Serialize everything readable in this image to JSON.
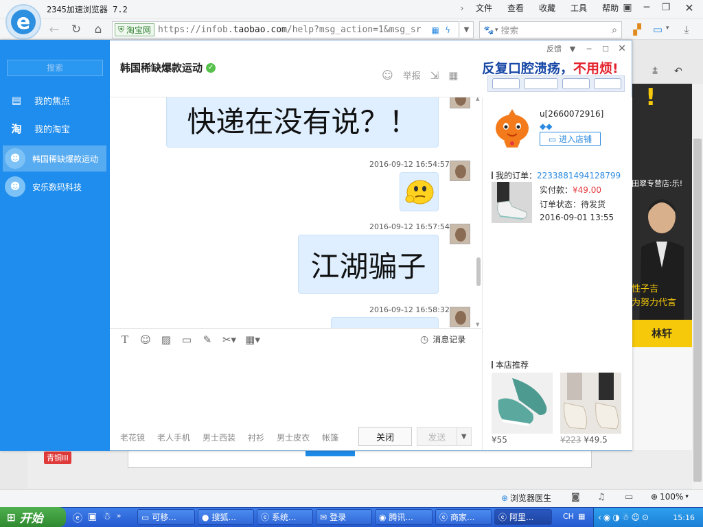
{
  "browser": {
    "title": "2345加速浏览器 7.2",
    "menu": [
      "文件",
      "查看",
      "收藏",
      "工具",
      "帮助"
    ],
    "site_badge": "淘宝网",
    "url_prefix": "https://infob.",
    "url_domain": "taobao.com",
    "url_rest": "/help?msg_action=1&msg_sr",
    "search_placeholder": "搜索",
    "icons": [
      "back-icon",
      "refresh-icon",
      "home-icon",
      "lightning-icon",
      "download-icon"
    ]
  },
  "background_page": {
    "banner_top": "!",
    "banner_shop": "田翠专营店:乐!",
    "banner_slogan": "性子吉\n为努力代言",
    "banner_name": "林轩",
    "badge": "青铜III"
  },
  "chat": {
    "window_controls": {
      "feedback": "反馈"
    },
    "sidebar": {
      "search": "搜索",
      "items": [
        {
          "label": "我的焦点",
          "icon": "focus-icon"
        },
        {
          "label": "我的淘宝",
          "icon": "taobao-icon"
        },
        {
          "label": "韩国稀缺爆款运动",
          "icon": "store-avatar",
          "active": true
        },
        {
          "label": "安乐数码科技",
          "icon": "store-avatar"
        }
      ]
    },
    "header": {
      "title": "韩国稀缺爆款运动",
      "report": "举报"
    },
    "ad": {
      "text_blue": "反复口腔溃疡，",
      "text_red": "不用烦!"
    },
    "messages": [
      {
        "text": "快递在没有说？！"
      },
      {
        "time": "2016-09-12 16:54:57",
        "type": "emoji"
      },
      {
        "time": "2016-09-12 16:57:54",
        "text": "江湖骗子"
      },
      {
        "time": "2016-09-12 16:58:32"
      }
    ],
    "input": {
      "history_label": "消息记录",
      "phrases": [
        "老花镜",
        "老人手机",
        "男士西装",
        "衬衫",
        "男士皮衣",
        "帐篷"
      ],
      "close_label": "关闭",
      "send_label": "发送"
    },
    "info": {
      "user": "u[2660072916]",
      "diamonds": "💎💎",
      "enter_shop": "进入店铺",
      "order_label": "我的订单：",
      "order_no": "2233881494128799",
      "paid_label": "实付款：",
      "paid_value": "¥49.00",
      "status_label": "订单状态：",
      "status_value": "待发货",
      "order_date": "2016-09-01 13:55",
      "recommend_label": "本店推荐",
      "rec1_price": "¥55",
      "rec2_old": "¥223",
      "rec2_price": "¥49.5"
    }
  },
  "statusbar": {
    "doctor": "浏览器医生",
    "zoom": "100%"
  },
  "taskbar": {
    "start": "开始",
    "items": [
      "可移...",
      "搜狐...",
      "系统...",
      "登录",
      "腾讯...",
      "商家...",
      "阿里..."
    ],
    "lang": "CH",
    "clock": "15:16"
  },
  "colors": {
    "sidebar": "#1f8ded",
    "bubble": "#dfefff",
    "price_red": "#e4393c",
    "link_blue": "#2b8ae0"
  }
}
